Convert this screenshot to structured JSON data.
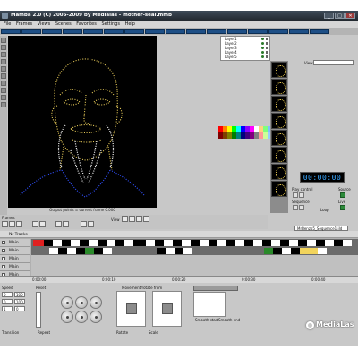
{
  "window": {
    "title": "Mamba 2.0 (C) 2005-2009 by Medialas - mother-seal.mmb",
    "controls": [
      "_",
      "□",
      "✕"
    ]
  },
  "menu": [
    "File",
    "Frames",
    "Views",
    "Scenes",
    "Favorites",
    "Settings",
    "Help"
  ],
  "layers": [
    {
      "label": "Layer1"
    },
    {
      "label": "Layer2"
    },
    {
      "label": "Layer3"
    },
    {
      "label": "Layer4"
    },
    {
      "label": "Layer5"
    }
  ],
  "preview": {
    "caption": "Output points = current frame 0.000"
  },
  "right_panel": {
    "view_label": "View",
    "time_display": "00:00:00",
    "play_control_label": "Play control",
    "sequence_label": "Sequence",
    "loop_label": "Loop",
    "source_label": "Source",
    "live_label": "Live",
    "name_value": "MrBenzo5_Sequence1.ild"
  },
  "frames_row": {
    "frames_label": "Frames",
    "view_label": "View"
  },
  "tracks": {
    "header_label": "Nr Tracks",
    "items": [
      {
        "label": "Main"
      },
      {
        "label": "Main"
      },
      {
        "label": "Main"
      },
      {
        "label": "Main"
      },
      {
        "label": "Main"
      }
    ]
  },
  "ruler": [
    "0:00:00",
    "0:00:10",
    "0:00:20",
    "0:00:30",
    "0:00:40"
  ],
  "bottom": {
    "speed_label": "Speed",
    "reset_label": "Reset",
    "repeat_label": "Repeat",
    "transition_label": "Transition",
    "movement_label": "Movement/rotate from",
    "rotate_label": "Rotate",
    "scale_label": "Scale",
    "smooth_start": "Smooth start",
    "smooth_end": "Smooth end",
    "num_values": [
      "0",
      "100",
      "0",
      "100",
      "1",
      "0"
    ]
  },
  "logo": {
    "text": "MediaLas"
  },
  "colors": {
    "preview_bg": "#000000",
    "face_dots": "#f2d45c",
    "shoulder_dots": "#3050ff",
    "time_digits": "#3aa8ff",
    "tab_blue": "#1e4f86"
  }
}
